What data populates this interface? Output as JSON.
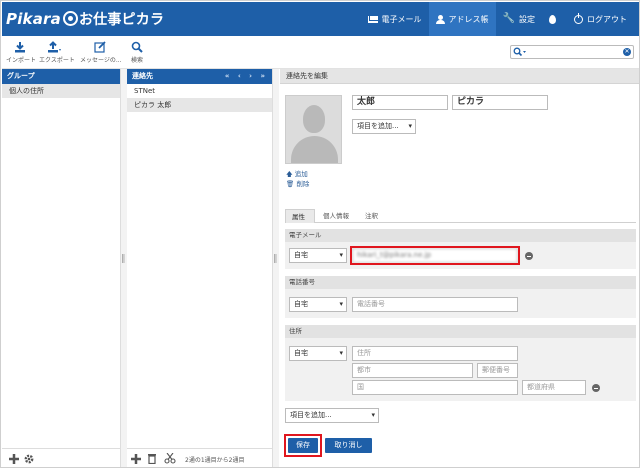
{
  "app": {
    "logo_main": "Pikara",
    "logo_sub": "お仕事ピカラ"
  },
  "topnav": [
    {
      "label": "電子メール",
      "icon": "mail-icon"
    },
    {
      "label": "アドレス帳",
      "icon": "person-icon",
      "active": true
    },
    {
      "label": "設定",
      "icon": "wrench-icon"
    },
    {
      "label": "",
      "icon": "drop-icon"
    },
    {
      "label": "ログアウト",
      "icon": "power-icon"
    }
  ],
  "toolbar": {
    "import_label": "インポート",
    "export_label": "エクスポート",
    "message_label": "メッセージの...",
    "search_label": "検索"
  },
  "search": {
    "value": ""
  },
  "groups": {
    "title": "グループ",
    "items": [
      "個人の住所"
    ]
  },
  "contacts": {
    "title": "連絡先",
    "pager": "« ‹ › »",
    "items": [
      "STNet",
      "ピカラ 太郎"
    ],
    "count_text": "2通の1通目から2通目"
  },
  "edit": {
    "title": "連絡先を編集",
    "first_name": "太郎",
    "last_name": "ピカラ",
    "add_field_label": "項目を追加...",
    "photo_add": "追加",
    "photo_delete": "削除",
    "tabs": [
      "属性",
      "個人情報",
      "注釈"
    ],
    "email": {
      "title": "電子メール",
      "type": "自宅",
      "value": "hikari_t@pikara.ne.jp"
    },
    "phone": {
      "title": "電話番号",
      "type": "自宅",
      "placeholder": "電話番号"
    },
    "address": {
      "title": "住所",
      "type": "自宅",
      "street_ph": "住所",
      "city_ph": "都市",
      "zip_ph": "郵便番号",
      "country_ph": "国",
      "region_ph": "都道府県"
    },
    "add_field_bottom": "項目を追加...",
    "save_label": "保存",
    "cancel_label": "取り消し"
  },
  "colors": {
    "brand": "#1e5fa8",
    "highlight": "#e0161e"
  }
}
